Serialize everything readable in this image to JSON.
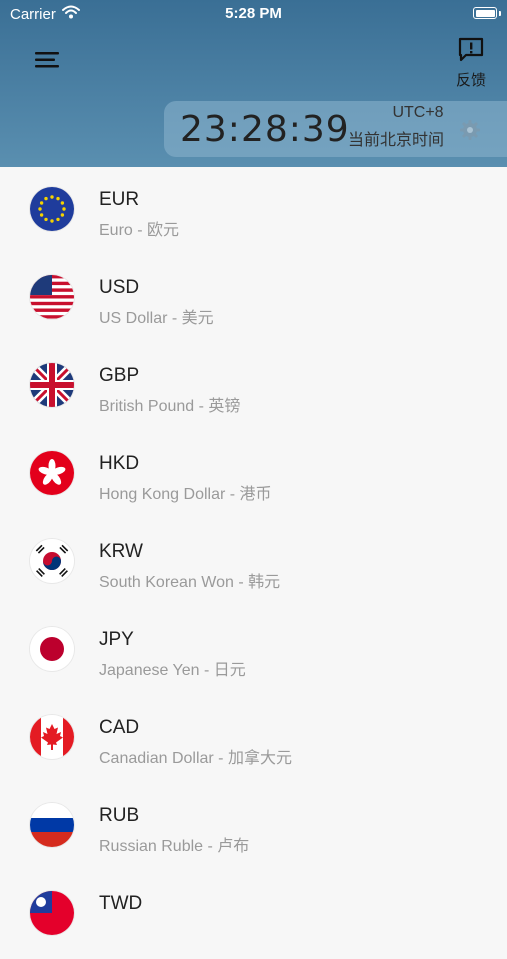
{
  "status_bar": {
    "carrier": "Carrier",
    "time": "5:28 PM"
  },
  "header": {
    "feedback_label": "反馈",
    "menu_icon": "menu-icon",
    "feedback_icon": "message-alert-icon"
  },
  "clock": {
    "time": "23:28:39",
    "timezone": "UTC+8",
    "location": "当前北京时间"
  },
  "currencies": [
    {
      "code": "EUR",
      "name": "Euro - 欧元",
      "flag": "eu-flag-icon"
    },
    {
      "code": "USD",
      "name": "US Dollar - 美元",
      "flag": "us-flag-icon"
    },
    {
      "code": "GBP",
      "name": "British Pound - 英镑",
      "flag": "uk-flag-icon"
    },
    {
      "code": "HKD",
      "name": "Hong Kong Dollar - 港币",
      "flag": "hk-flag-icon"
    },
    {
      "code": "KRW",
      "name": "South Korean Won - 韩元",
      "flag": "kr-flag-icon"
    },
    {
      "code": "JPY",
      "name": "Japanese Yen - 日元",
      "flag": "jp-flag-icon"
    },
    {
      "code": "CAD",
      "name": "Canadian Dollar - 加拿大元",
      "flag": "ca-flag-icon"
    },
    {
      "code": "RUB",
      "name": "Russian Ruble - 卢布",
      "flag": "ru-flag-icon"
    },
    {
      "code": "TWD",
      "name": "",
      "flag": "tw-flag-icon"
    }
  ]
}
